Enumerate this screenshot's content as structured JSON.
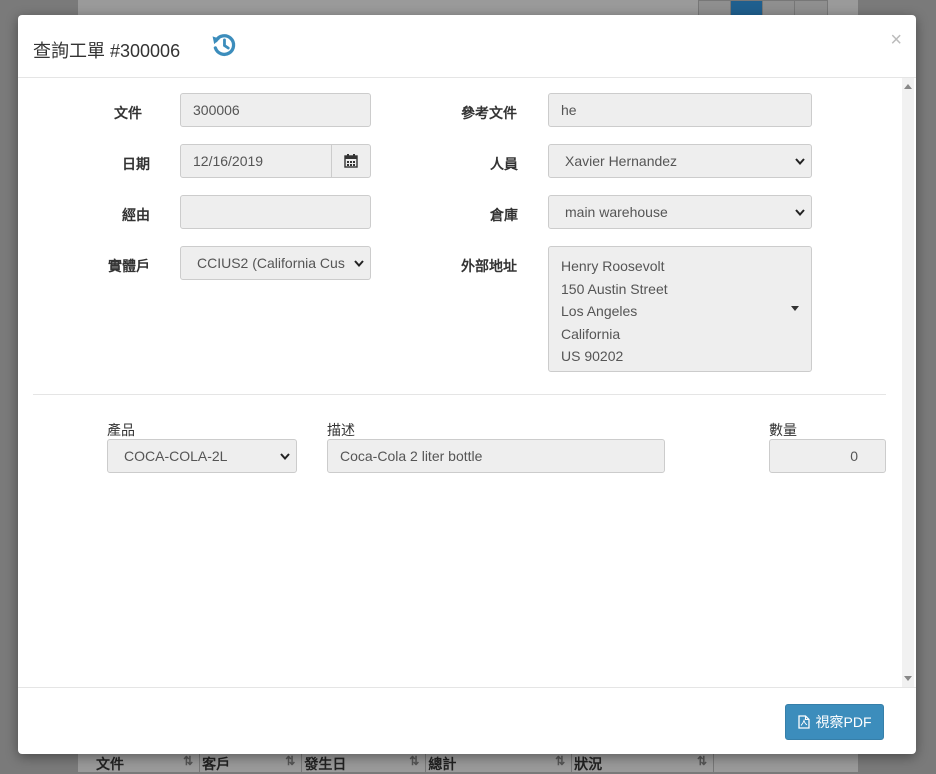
{
  "background": {
    "table_headers": [
      "文件",
      "客戶",
      "發生日",
      "總計",
      "狀況"
    ]
  },
  "modal": {
    "title": "查詢工單 #300006",
    "close": "×",
    "form": {
      "document_label": "文件",
      "document_value": "300006",
      "reference_label": "參考文件",
      "reference_value": "he",
      "date_label": "日期",
      "date_value": "12/16/2019",
      "staff_label": "人員",
      "staff_value": "Xavier Hernandez",
      "via_label": "經由",
      "via_value": "",
      "warehouse_label": "倉庫",
      "warehouse_value": "main warehouse",
      "entity_label": "實體戶",
      "entity_value": "CCIUS2 (California Cust",
      "address_label": "外部地址",
      "address_lines": [
        "Henry Roosevolt",
        "150 Austin Street",
        "Los Angeles",
        "California",
        "US 90202"
      ]
    },
    "lines": {
      "product_label": "產品",
      "description_label": "描述",
      "quantity_label": "數量",
      "rows": [
        {
          "product": "COCA-COLA-2L",
          "description": "Coca-Cola 2 liter bottle",
          "quantity": "0"
        }
      ]
    },
    "footer": {
      "pdf_button": "視察PDF"
    }
  },
  "colors": {
    "accent": "#3c8dbc",
    "history_icon": "#3c8dbc",
    "field_bg": "#eeeeee",
    "overlay": "#7a7a7a"
  },
  "icons": {
    "history": "history-icon",
    "calendar": "calendar-icon",
    "pdf": "file-pdf-icon",
    "close": "close-icon"
  }
}
